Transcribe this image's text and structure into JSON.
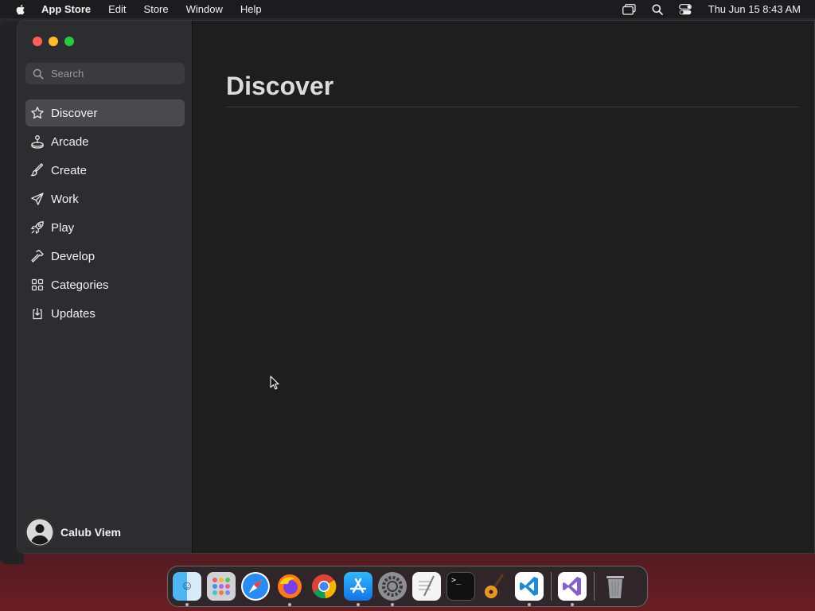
{
  "menubar": {
    "app_name": "App Store",
    "items": [
      "Edit",
      "Store",
      "Window",
      "Help"
    ],
    "clock": "Thu Jun 15  8:43 AM",
    "icons": [
      "screen-mirroring-icon",
      "spotlight-search-icon",
      "control-center-icon"
    ]
  },
  "window": {
    "traffic_lights": [
      "close",
      "minimize",
      "maximize"
    ],
    "search": {
      "placeholder": "Search",
      "value": ""
    },
    "sidebar": {
      "items": [
        {
          "label": "Discover",
          "icon": "star-icon",
          "active": true
        },
        {
          "label": "Arcade",
          "icon": "joystick-icon",
          "active": false
        },
        {
          "label": "Create",
          "icon": "brush-icon",
          "active": false
        },
        {
          "label": "Work",
          "icon": "paper-plane-icon",
          "active": false
        },
        {
          "label": "Play",
          "icon": "rocket-icon",
          "active": false
        },
        {
          "label": "Develop",
          "icon": "hammer-icon",
          "active": false
        },
        {
          "label": "Categories",
          "icon": "grid-icon",
          "active": false
        },
        {
          "label": "Updates",
          "icon": "download-box-icon",
          "active": false
        }
      ],
      "user_name": "Calub Viem"
    },
    "main": {
      "title": "Discover"
    }
  },
  "dock": {
    "apps": [
      {
        "name": "Finder",
        "running": true
      },
      {
        "name": "Launchpad",
        "running": false
      },
      {
        "name": "Safari",
        "running": false
      },
      {
        "name": "Firefox",
        "running": true
      },
      {
        "name": "Chrome",
        "running": false
      },
      {
        "name": "App Store",
        "running": true
      },
      {
        "name": "System Settings",
        "running": true
      },
      {
        "name": "TextEdit",
        "running": false
      },
      {
        "name": "Terminal",
        "running": false
      },
      {
        "name": "GarageBand",
        "running": false
      },
      {
        "name": "Visual Studio Code",
        "running": true
      },
      {
        "name": "Visual Studio",
        "running": true
      },
      {
        "name": "Trash",
        "running": false
      }
    ]
  },
  "colors": {
    "close": "#ff5f57",
    "minimize": "#febc2e",
    "maximize": "#28c840",
    "sidebar_bg": "#2d2d2f",
    "content_bg": "#1e1e1e",
    "active_item": "#4a4a4c"
  }
}
